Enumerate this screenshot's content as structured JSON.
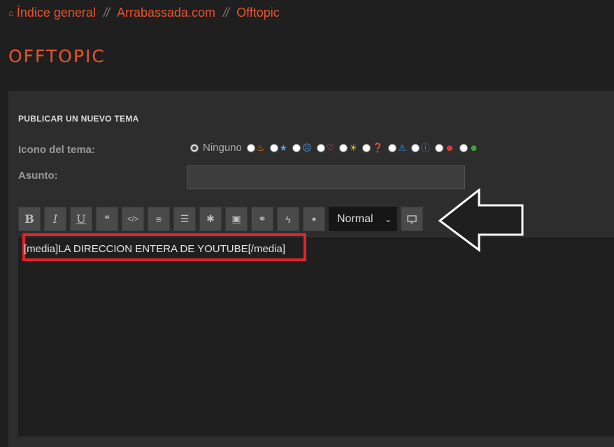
{
  "breadcrumb": {
    "home": "Índice general",
    "site": "Arrabassada.com",
    "forum": "Offtopic",
    "sep": "//"
  },
  "page_title": "OFFTOPIC",
  "form": {
    "section_title": "PUBLICAR UN NUEVO TEMA",
    "topic_icon_label": "Icono del tema:",
    "none_label": "Ninguno",
    "subject_label": "Asunto:",
    "subject_value": ""
  },
  "icons": [
    "fire",
    "star",
    "surprised",
    "heart",
    "lightbulb",
    "question",
    "warning",
    "info",
    "red-face",
    "green-face"
  ],
  "toolbar": {
    "bold": "B",
    "italic": "I",
    "underline": "U",
    "quote": "❝",
    "code": "</>",
    "list": "≡",
    "olist": "☰",
    "asterisk": "✱",
    "image": "▣",
    "link": "⚭",
    "flash": "ϟ",
    "color": "●",
    "size_selected": "Normal"
  },
  "editor": {
    "text": "[media]LA DIRECCION ENTERA DE YOUTUBE[/media]"
  },
  "colors": {
    "accent": "#e8542b",
    "highlight": "#e0232b"
  }
}
